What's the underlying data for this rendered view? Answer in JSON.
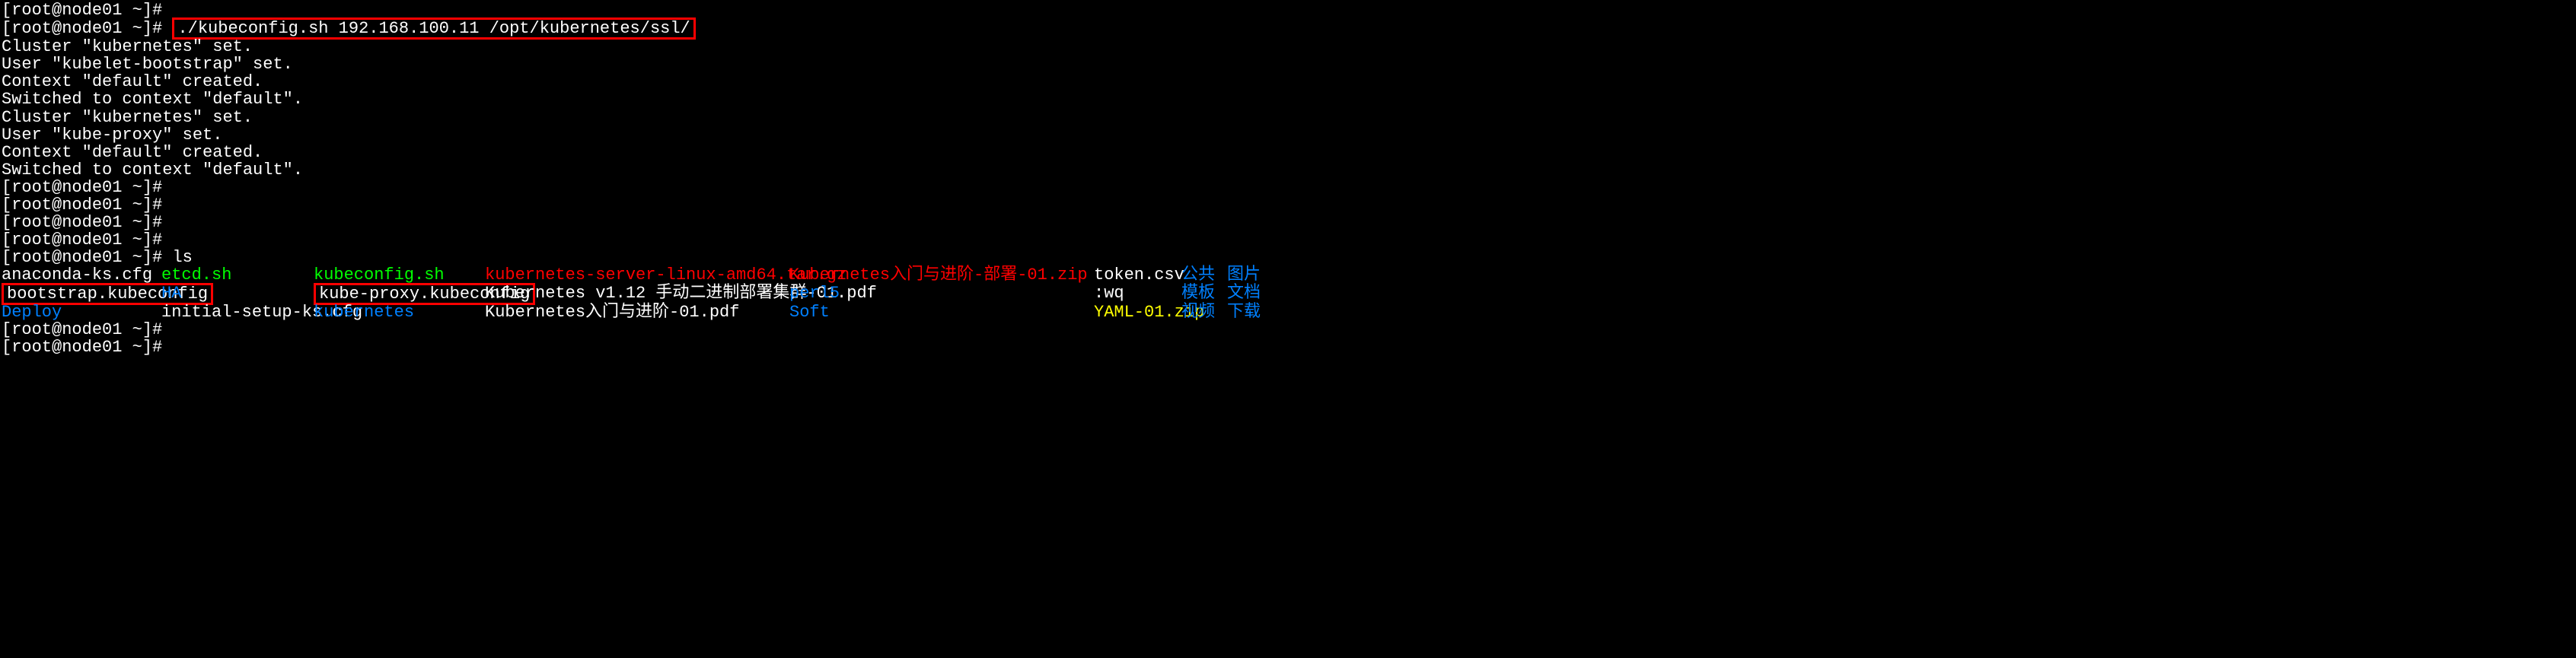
{
  "prompts": {
    "p1": "[root@node01 ~]# ",
    "cmd1": "./kubeconfig.sh 192.168.100.11 /opt/kubernetes/ssl/",
    "cmd2": "ls"
  },
  "output": {
    "l1": "Cluster \"kubernetes\" set.",
    "l2": "User \"kubelet-bootstrap\" set.",
    "l3": "Context \"default\" created.",
    "l4": "Switched to context \"default\".",
    "l5": "Cluster \"kubernetes\" set.",
    "l6": "User \"kube-proxy\" set.",
    "l7": "Context \"default\" created.",
    "l8": "Switched to context \"default\"."
  },
  "ls": {
    "r1c1": "anaconda-ks.cfg",
    "r1c2": "etcd.sh",
    "r1c3": "kubeconfig.sh",
    "r1c4": "kubernetes-server-linux-amd64.tar.gz",
    "r1c5": "Kubernetes入门与进阶-部署-01.zip",
    "r1c6": "token.csv",
    "r1c7": "公共",
    "r1c8": "图片",
    "r2c1": "bootstrap.kubeconfig",
    "r2c2": "HA",
    "r2c3": "kube-proxy.kubeconfig",
    "r2c4": "Kubernetes v1.12 手动二进制部署集群-01.pdf",
    "r2c5": "perl5",
    "r2c6": ":wq",
    "r2c7": "模板",
    "r2c8": "文档",
    "r3c1": "Deploy",
    "r3c2": "initial-setup-ks.cfg",
    "r3c3": "kubernetes",
    "r3c4": "Kubernetes入门与进阶-01.pdf",
    "r3c5": "Soft",
    "r3c6": "YAML-01.zip",
    "r3c7": "视频",
    "r3c8": "下载"
  }
}
